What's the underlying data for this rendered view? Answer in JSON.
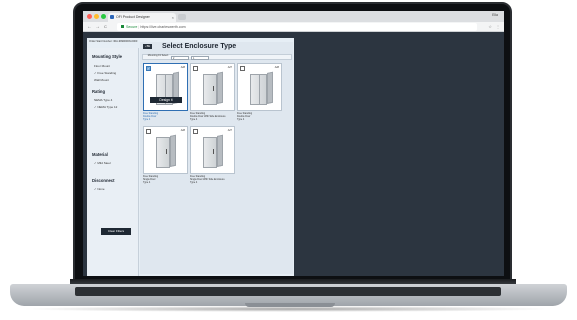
{
  "browser": {
    "tab_title": "OFI Product Designer",
    "user_label": "Ella",
    "url_secure": "Secure",
    "url": "https://live.charleswerth.com",
    "nav_back": "←",
    "nav_forward": "→",
    "nav_reload": "C",
    "star": "☆",
    "menu": "⋮",
    "traffic_colors": [
      "#ff5f57",
      "#ffbd2e",
      "#28c840"
    ]
  },
  "app": {
    "top_text": "Order Start Number: 30A-9999000N-0000",
    "sidebar": {
      "sections": [
        {
          "title": "Mounting Style",
          "options": [
            "Floor Mount",
            "Free Standing",
            "Wall Mount"
          ]
        },
        {
          "title": "Rating",
          "options": [
            "NEMA Type 4",
            "NEMA Type 12"
          ]
        },
        {
          "title": "Material",
          "options": [
            "Mild Steel"
          ]
        },
        {
          "title": "Disconnect",
          "options": [
            "None"
          ]
        }
      ],
      "clear_label": "Clear Filters"
    },
    "main": {
      "back_label": "‹ Bk",
      "title": "Select Enclosure Type",
      "filter_label": "Mounting Fit Select",
      "filter_a": "2",
      "filter_b": "1",
      "cards": [
        {
          "sku": "A28",
          "hover": "Design it",
          "caption": [
            "Free Standing",
            "Double Door",
            "Type 4"
          ],
          "selected": true
        },
        {
          "sku": "A27",
          "caption": [
            "Free Standing",
            "Double Door With Side Enclosure",
            "Type 4"
          ],
          "selected": false
        },
        {
          "sku": "A28",
          "caption": [
            "Free Standing",
            "Double Door",
            "Type 4"
          ],
          "selected": false
        },
        {
          "sku": "A28",
          "caption": [
            "Free Standing",
            "Single Door",
            "Type 4"
          ],
          "selected": false
        },
        {
          "sku": "A27",
          "caption": [
            "Free Standing",
            "Single Door With Side Enclosure",
            "Type 4"
          ],
          "selected": false
        }
      ]
    }
  }
}
